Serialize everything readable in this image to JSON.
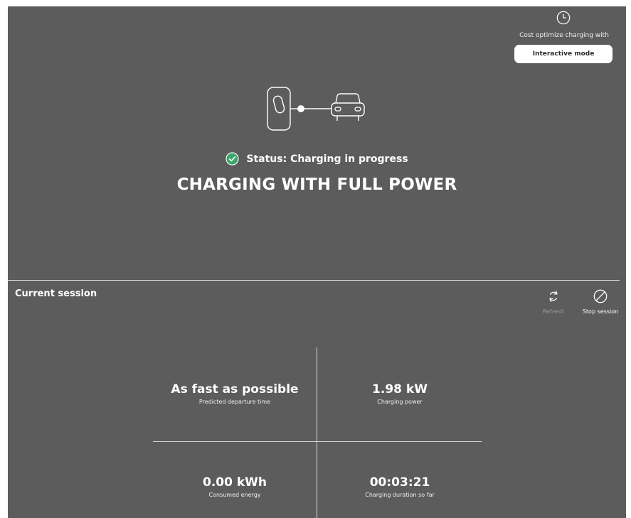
{
  "optimize": {
    "label": "Cost optimize charging with",
    "button_label": "Interactive mode",
    "icon": "clock-icon"
  },
  "graphic": {
    "charger_icon": "charger-icon",
    "car_icon": "car-icon"
  },
  "status": {
    "text": "Status: Charging in progress",
    "icon": "check-circle-icon",
    "icon_color": "#3aa66a",
    "headline": "CHARGING WITH FULL POWER"
  },
  "session": {
    "title": "Current session",
    "actions": {
      "refresh_label": "Refresh",
      "stop_label": "Stop session"
    },
    "metrics": {
      "departure": {
        "value": "As fast as possible",
        "caption": "Predicted departure time"
      },
      "power": {
        "value": "1.98 kW",
        "caption": "Charging power"
      },
      "energy": {
        "value": "0.00 kWh",
        "caption": "Consumed energy"
      },
      "duration": {
        "value": "00:03:21",
        "caption": "Charging duration so far"
      }
    }
  },
  "colors": {
    "panel": "#5c5c5c",
    "divider": "#d8d8d8",
    "disabled_text": "#9a9a9a"
  }
}
